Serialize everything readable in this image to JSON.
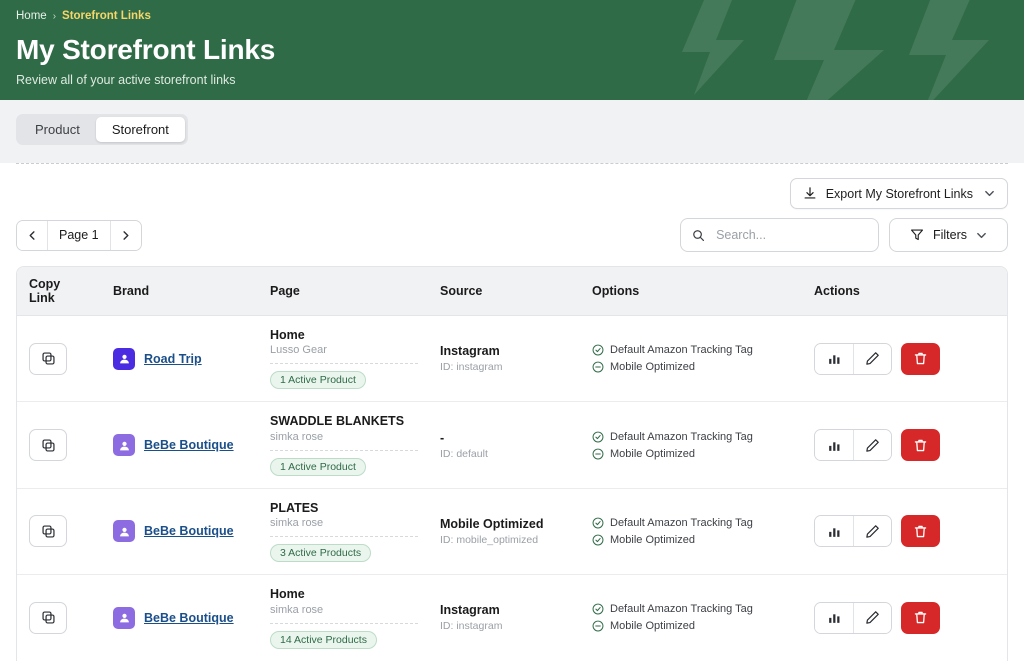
{
  "header": {
    "breadcrumb": {
      "home": "Home",
      "separator": "›",
      "current": "Storefront Links"
    },
    "title": "My Storefront Links",
    "subtitle": "Review all of your active storefront links",
    "bg_color": "#2f6b46",
    "accent_color": "#f6d66a"
  },
  "tabs": [
    {
      "label": "Product",
      "active": false
    },
    {
      "label": "Storefront",
      "active": true
    }
  ],
  "toolbar": {
    "export_label": "Export My Storefront Links",
    "export_icon": "download-icon",
    "export_chevron": "chevron-down-icon"
  },
  "pager": {
    "prev_icon": "chevron-left-icon",
    "next_icon": "chevron-right-icon",
    "label": "Page 1"
  },
  "search": {
    "placeholder": "Search...",
    "value": "",
    "icon": "search-icon"
  },
  "filters": {
    "label": "Filters",
    "icon": "funnel-icon",
    "chevron": "chevron-down-icon"
  },
  "table": {
    "columns": [
      "Copy Link",
      "Brand",
      "Page",
      "Source",
      "Options",
      "Actions"
    ],
    "rows": [
      {
        "copy_icon": "copy-icon",
        "brand": {
          "name": "Road Trip",
          "logo_color": "#4b2ce0",
          "logo_glyph": "●"
        },
        "page": {
          "name": "Home",
          "brand": "Lusso Gear",
          "badge": "1 Active Product"
        },
        "source": {
          "name": "Instagram",
          "id": "ID: instagram"
        },
        "options": [
          {
            "icon": "check-circle-icon",
            "label": "Default Amazon Tracking Tag",
            "state": "enabled",
            "color": "#2f6b46"
          },
          {
            "icon": "minus-circle-icon",
            "label": "Mobile Optimized",
            "state": "disabled",
            "color": "#2f6b46"
          }
        ],
        "actions": {
          "stats_icon": "bar-chart-icon",
          "edit_icon": "pencil-icon",
          "delete_icon": "trash-icon"
        }
      },
      {
        "copy_icon": "copy-icon",
        "brand": {
          "name": "BeBe Boutique",
          "logo_color": "#8d6be0",
          "logo_glyph": "●"
        },
        "page": {
          "name": "SWADDLE BLANKETS",
          "brand": "simka rose",
          "badge": "1 Active Product"
        },
        "source": {
          "name": "-",
          "id": "ID: default"
        },
        "options": [
          {
            "icon": "check-circle-icon",
            "label": "Default Amazon Tracking Tag",
            "state": "enabled",
            "color": "#2f6b46"
          },
          {
            "icon": "minus-circle-icon",
            "label": "Mobile Optimized",
            "state": "disabled",
            "color": "#2f6b46"
          }
        ],
        "actions": {
          "stats_icon": "bar-chart-icon",
          "edit_icon": "pencil-icon",
          "delete_icon": "trash-icon"
        }
      },
      {
        "copy_icon": "copy-icon",
        "brand": {
          "name": "BeBe Boutique",
          "logo_color": "#8d6be0",
          "logo_glyph": "●"
        },
        "page": {
          "name": "PLATES",
          "brand": "simka rose",
          "badge": "3 Active Products"
        },
        "source": {
          "name": "Mobile Optimized",
          "id": "ID: mobile_optimized"
        },
        "options": [
          {
            "icon": "check-circle-icon",
            "label": "Default Amazon Tracking Tag",
            "state": "enabled",
            "color": "#2f6b46"
          },
          {
            "icon": "check-circle-icon",
            "label": "Mobile Optimized",
            "state": "enabled",
            "color": "#2f6b46"
          }
        ],
        "actions": {
          "stats_icon": "bar-chart-icon",
          "edit_icon": "pencil-icon",
          "delete_icon": "trash-icon"
        }
      },
      {
        "copy_icon": "copy-icon",
        "brand": {
          "name": "BeBe Boutique",
          "logo_color": "#8d6be0",
          "logo_glyph": "●"
        },
        "page": {
          "name": "Home",
          "brand": "simka rose",
          "badge": "14 Active Products"
        },
        "source": {
          "name": "Instagram",
          "id": "ID: instagram"
        },
        "options": [
          {
            "icon": "check-circle-icon",
            "label": "Default Amazon Tracking Tag",
            "state": "enabled",
            "color": "#2f6b46"
          },
          {
            "icon": "minus-circle-icon",
            "label": "Mobile Optimized",
            "state": "disabled",
            "color": "#2f6b46"
          }
        ],
        "actions": {
          "stats_icon": "bar-chart-icon",
          "edit_icon": "pencil-icon",
          "delete_icon": "trash-icon"
        }
      }
    ]
  }
}
